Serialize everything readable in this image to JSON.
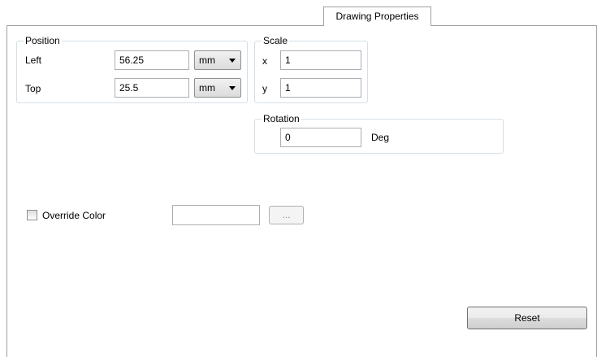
{
  "tab": {
    "label": "Drawing Properties"
  },
  "position": {
    "title": "Position",
    "left": {
      "label": "Left",
      "value": "56.25",
      "unit": "mm"
    },
    "top": {
      "label": "Top",
      "value": "25.5",
      "unit": "mm"
    }
  },
  "scale": {
    "title": "Scale",
    "x": {
      "label": "x",
      "value": "1"
    },
    "y": {
      "label": "y",
      "value": "1"
    }
  },
  "rotation": {
    "title": "Rotation",
    "value": "0",
    "unit": "Deg"
  },
  "override_color": {
    "label": "Override Color",
    "checked": false,
    "color_value": "",
    "browse_label": "..."
  },
  "reset": {
    "label": "Reset"
  }
}
